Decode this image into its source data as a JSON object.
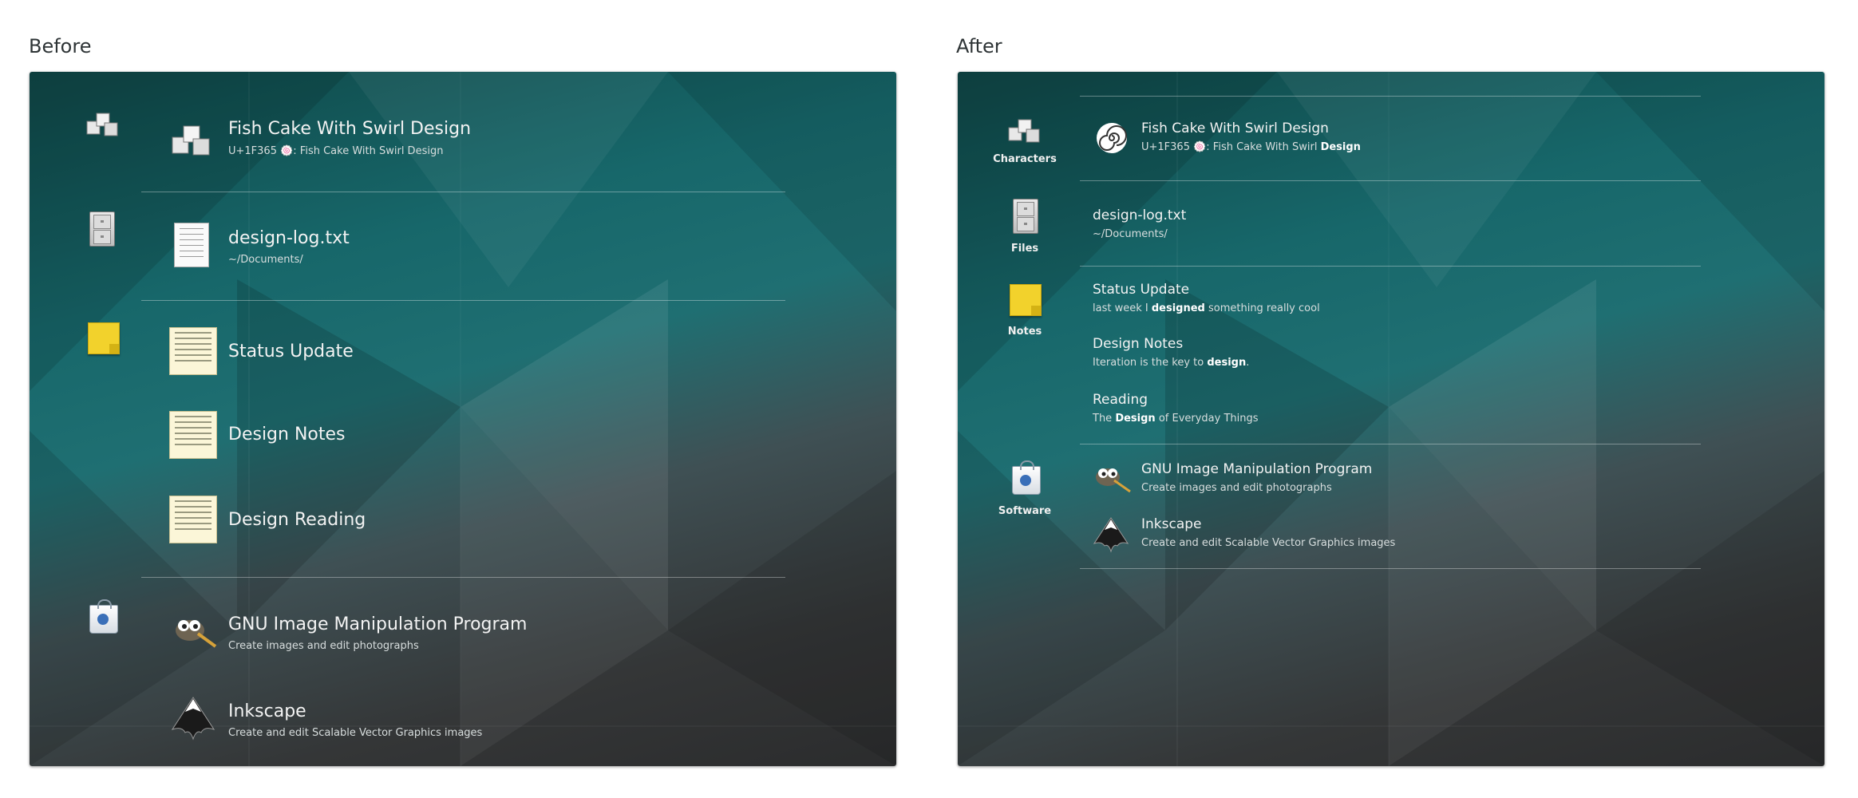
{
  "before": {
    "title": "Before",
    "results": [
      {
        "title": "Fish Cake With Swirl Design",
        "subtitle": "U+1F365 🍥: Fish Cake With Swirl Design",
        "icon": "characters-icon"
      },
      {
        "title": "design-log.txt",
        "subtitle": "~/Documents/",
        "icon": "text-document-icon"
      },
      {
        "title": "Status Update",
        "icon": "note-thumbnail-icon"
      },
      {
        "title": "Design Notes",
        "icon": "note-thumbnail-icon"
      },
      {
        "title": "Design Reading",
        "icon": "note-thumbnail-icon"
      },
      {
        "title": "GNU Image Manipulation Program",
        "subtitle": "Create images and edit photographs",
        "icon": "gimp-icon"
      },
      {
        "title": "Inkscape",
        "subtitle": "Create and edit Scalable Vector Graphics images",
        "icon": "inkscape-icon"
      }
    ]
  },
  "after": {
    "title": "After",
    "providers": [
      {
        "label": "Characters",
        "icon": "characters-icon"
      },
      {
        "label": "Files",
        "icon": "files-icon"
      },
      {
        "label": "Notes",
        "icon": "notes-icon"
      },
      {
        "label": "Software",
        "icon": "software-icon"
      }
    ],
    "results": {
      "char": {
        "title": "Fish Cake With Swirl Design",
        "sub_pre": "U+1F365 🍥: Fish Cake With Swirl ",
        "sub_bold": "Design"
      },
      "file": {
        "title": "design-log.txt",
        "subtitle": "~/Documents/"
      },
      "note1": {
        "title": "Status Update",
        "sub_pre": "last week I ",
        "sub_bold": "designed",
        "sub_post": " something really cool"
      },
      "note2": {
        "title": "Design Notes",
        "sub_pre": "Iteration is the key to ",
        "sub_bold": "design",
        "sub_post": "."
      },
      "note3": {
        "title": "Reading",
        "sub_pre": "The ",
        "sub_bold": "Design",
        "sub_post": " of Everyday Things"
      },
      "app1": {
        "title": "GNU Image Manipulation Program",
        "subtitle": "Create images and edit photographs"
      },
      "app2": {
        "title": "Inkscape",
        "subtitle": "Create and edit Scalable Vector Graphics images"
      }
    }
  },
  "colors": {
    "background_dark": "#0f4747",
    "background_teal": "#1f6f72",
    "background_gray": "#343637",
    "text": "#f3f3f3"
  }
}
